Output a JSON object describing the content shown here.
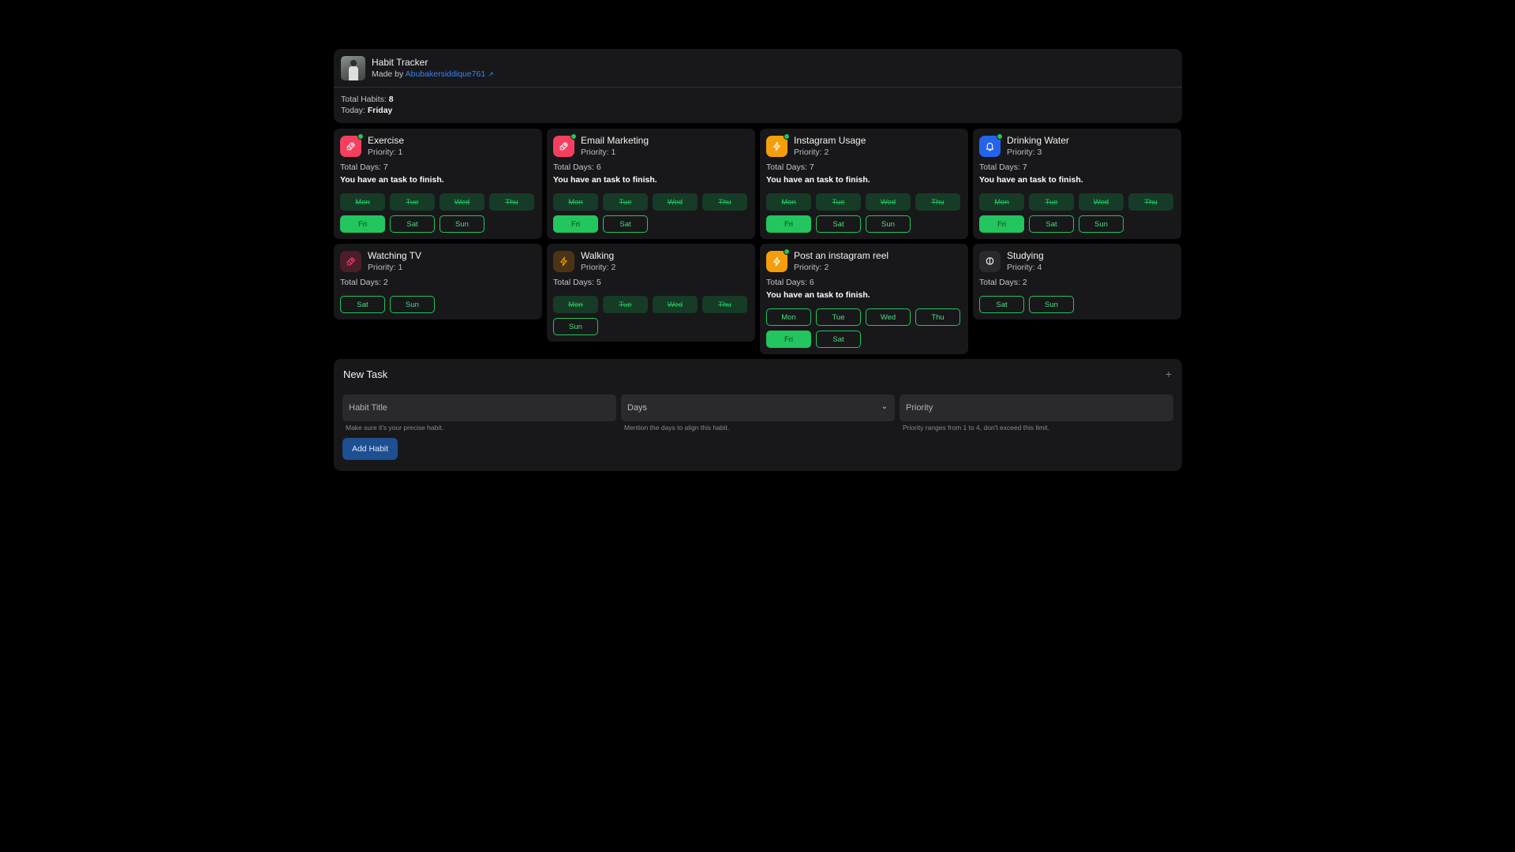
{
  "header": {
    "title": "Habit Tracker",
    "made_by_prefix": "Made by",
    "author": "Abubakersiddique761",
    "total_habits_label": "Total Habits:",
    "total_habits": "8",
    "today_label": "Today:",
    "today": "Friday"
  },
  "habits": [
    {
      "title": "Exercise",
      "priority": "Priority: 1",
      "total_days": "Total Days: 7",
      "note": "You have an task to finish.",
      "icon": "rocket-icon",
      "color": "#f43f5e",
      "active": true,
      "days": [
        {
          "label": "Mon",
          "state": "done"
        },
        {
          "label": "Tue",
          "state": "done"
        },
        {
          "label": "Wed",
          "state": "done"
        },
        {
          "label": "Thu",
          "state": "done"
        },
        {
          "label": "Fri",
          "state": "today"
        },
        {
          "label": "Sat",
          "state": "todo"
        },
        {
          "label": "Sun",
          "state": "todo"
        }
      ]
    },
    {
      "title": "Email Marketing",
      "priority": "Priority: 1",
      "total_days": "Total Days: 6",
      "note": "You have an task to finish.",
      "icon": "rocket-icon",
      "color": "#f43f5e",
      "active": true,
      "days": [
        {
          "label": "Mon",
          "state": "done"
        },
        {
          "label": "Tue",
          "state": "done"
        },
        {
          "label": "Wed",
          "state": "done"
        },
        {
          "label": "Thu",
          "state": "done"
        },
        {
          "label": "Fri",
          "state": "today"
        },
        {
          "label": "Sat",
          "state": "todo"
        }
      ]
    },
    {
      "title": "Instagram Usage",
      "priority": "Priority: 2",
      "total_days": "Total Days: 7",
      "note": "You have an task to finish.",
      "icon": "lightning-icon",
      "color": "#f59e0b",
      "active": true,
      "days": [
        {
          "label": "Mon",
          "state": "done"
        },
        {
          "label": "Tue",
          "state": "done"
        },
        {
          "label": "Wed",
          "state": "done"
        },
        {
          "label": "Thu",
          "state": "done"
        },
        {
          "label": "Fri",
          "state": "today"
        },
        {
          "label": "Sat",
          "state": "todo"
        },
        {
          "label": "Sun",
          "state": "todo"
        }
      ]
    },
    {
      "title": "Drinking Water",
      "priority": "Priority: 3",
      "total_days": "Total Days: 7",
      "note": "You have an task to finish.",
      "icon": "bell-icon",
      "color": "#2563eb",
      "active": true,
      "days": [
        {
          "label": "Mon",
          "state": "done"
        },
        {
          "label": "Tue",
          "state": "done"
        },
        {
          "label": "Wed",
          "state": "done"
        },
        {
          "label": "Thu",
          "state": "done"
        },
        {
          "label": "Fri",
          "state": "today"
        },
        {
          "label": "Sat",
          "state": "todo"
        },
        {
          "label": "Sun",
          "state": "todo"
        }
      ]
    },
    {
      "title": "Watching TV",
      "priority": "Priority: 1",
      "total_days": "Total Days: 2",
      "note": "",
      "icon": "rocket-icon",
      "color": "#4c1d2a",
      "active": false,
      "days": [
        {
          "label": "Sat",
          "state": "todo"
        },
        {
          "label": "Sun",
          "state": "todo"
        }
      ]
    },
    {
      "title": "Walking",
      "priority": "Priority: 2",
      "total_days": "Total Days: 5",
      "note": "",
      "icon": "lightning-icon",
      "color": "#4a3415",
      "active": false,
      "days": [
        {
          "label": "Mon",
          "state": "done"
        },
        {
          "label": "Tue",
          "state": "done"
        },
        {
          "label": "Wed",
          "state": "done"
        },
        {
          "label": "Thu",
          "state": "done"
        },
        {
          "label": "Sun",
          "state": "todo"
        }
      ]
    },
    {
      "title": "Post an instagram reel",
      "priority": "Priority: 2",
      "total_days": "Total Days: 6",
      "note": "You have an task to finish.",
      "icon": "lightning-icon",
      "color": "#f59e0b",
      "active": true,
      "days": [
        {
          "label": "Mon",
          "state": "todo"
        },
        {
          "label": "Tue",
          "state": "todo"
        },
        {
          "label": "Wed",
          "state": "todo"
        },
        {
          "label": "Thu",
          "state": "todo"
        },
        {
          "label": "Fri",
          "state": "today"
        },
        {
          "label": "Sat",
          "state": "todo"
        }
      ]
    },
    {
      "title": "Studying",
      "priority": "Priority: 4",
      "total_days": "Total Days: 2",
      "note": "",
      "icon": "brain-icon",
      "color": "#2a2a2d",
      "active": false,
      "days": [
        {
          "label": "Sat",
          "state": "todo"
        },
        {
          "label": "Sun",
          "state": "todo"
        }
      ]
    }
  ],
  "new_task": {
    "title": "New Task",
    "habit_title_placeholder": "Habit Title",
    "habit_title_hint": "Make sure it's your precise habit.",
    "days_placeholder": "Days",
    "days_hint": "Mention the days to align this habit.",
    "priority_placeholder": "Priority",
    "priority_hint": "Priority ranges from 1 to 4, don't exceed this limit.",
    "add_button": "Add Habit"
  }
}
